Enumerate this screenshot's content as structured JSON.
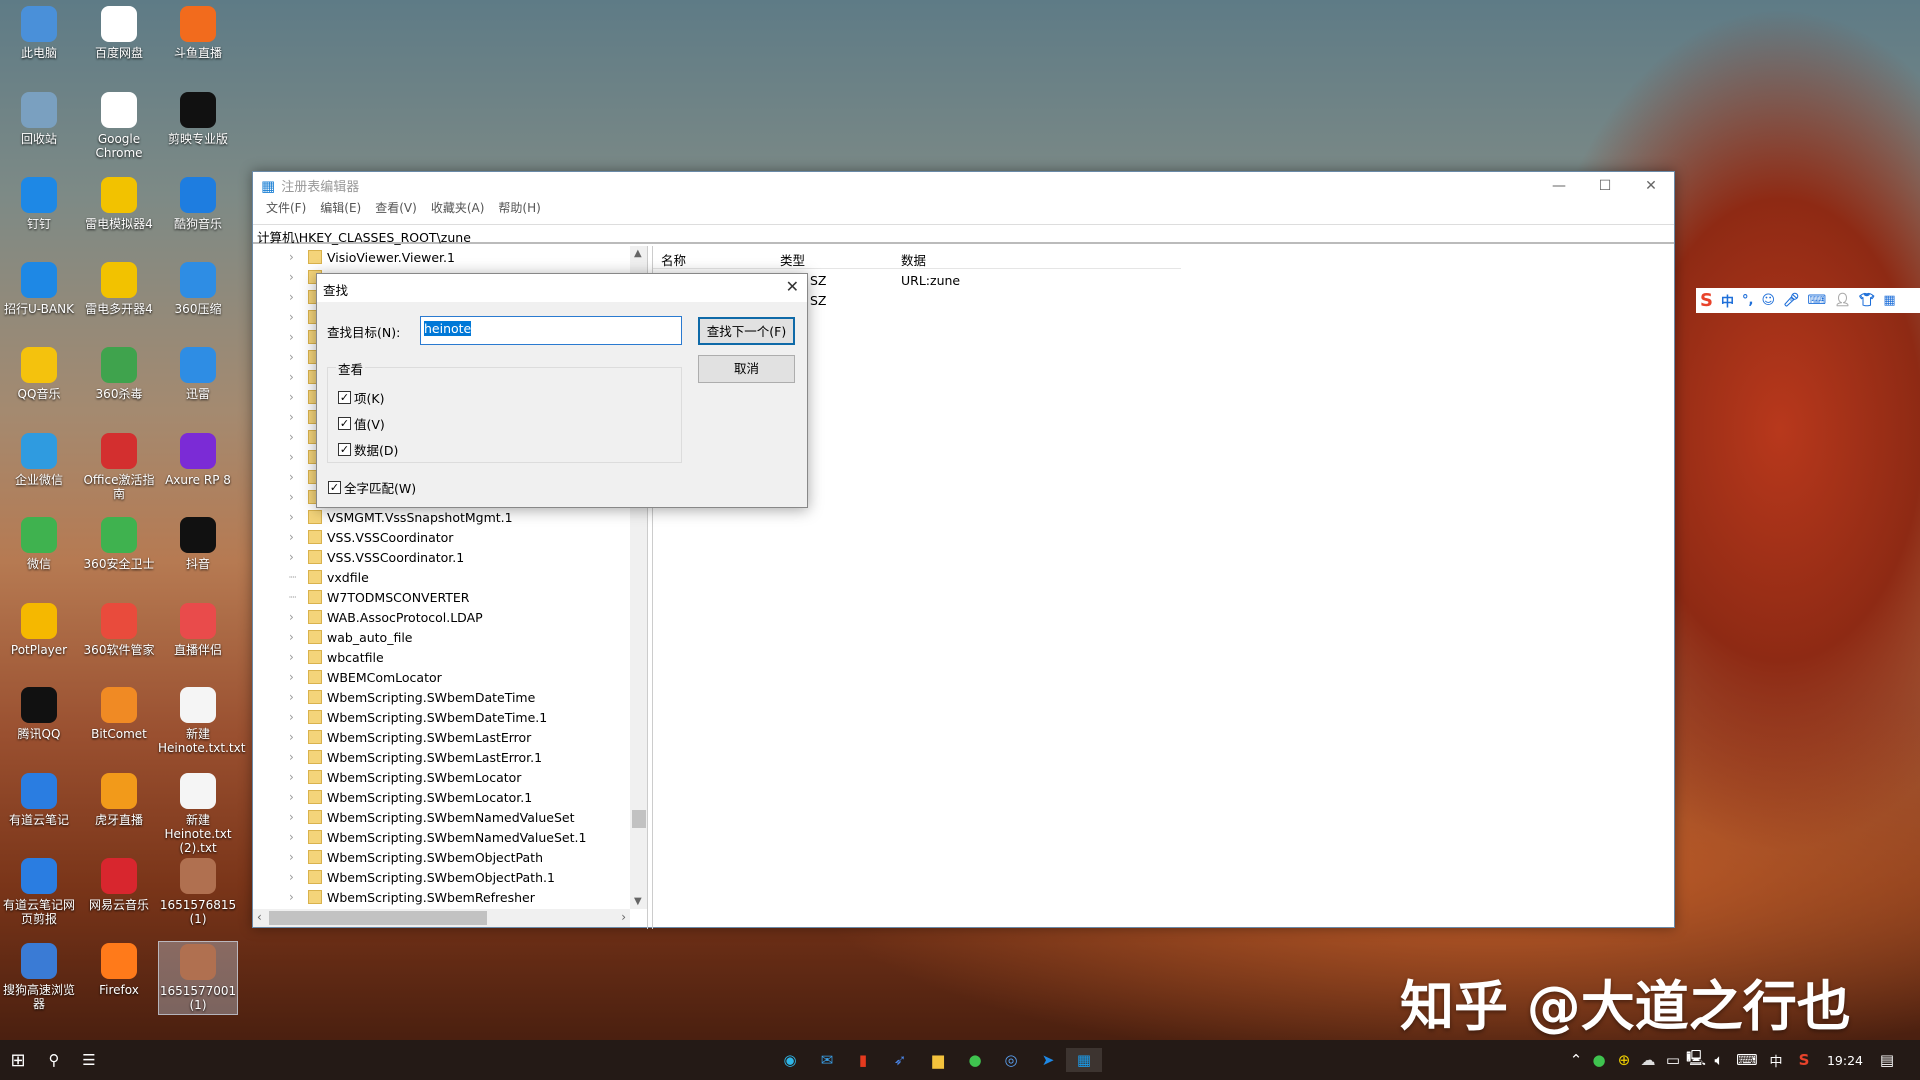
{
  "desktop": {
    "columns": [
      [
        "此电脑",
        "回收站",
        "钉钉",
        "招行U-BANK",
        "QQ音乐",
        "企业微信",
        "微信",
        "PotPlayer",
        "腾讯QQ",
        "有道云笔记",
        "有道云笔记网页剪报",
        "搜狗高速浏览器"
      ],
      [
        "百度网盘",
        "Google Chrome",
        "雷电模拟器4",
        "雷电多开器4",
        "360杀毒",
        "Office激活指南",
        "360安全卫士",
        "360软件管家",
        "BitComet",
        "虎牙直播",
        "网易云音乐",
        "Firefox"
      ],
      [
        "斗鱼直播",
        "剪映专业版",
        "酷狗音乐",
        "360压缩",
        "迅雷",
        "Axure RP 8",
        "抖音",
        "直播伴侣",
        "新建Heinote.txt.txt",
        "新建Heinote.txt (2).txt",
        "1651576815 (1)",
        "1651577001 (1)"
      ]
    ],
    "colors": [
      [
        "#4a90d9",
        "#7aa0c0",
        "#1e88e5",
        "#1e88e5",
        "#f4c20d",
        "#2f9be0",
        "#3fb24f",
        "#f5b800",
        "#111",
        "#2a7de1",
        "#2a7de1",
        "#3a7bd5"
      ],
      [
        "#ffffff",
        "#ffffff",
        "#f2c200",
        "#f2c200",
        "#3fa34d",
        "#d32f2f",
        "#3fb24f",
        "#e94b3c",
        "#f08a24",
        "#f29a1a",
        "#d8262e",
        "#ff7a1a"
      ],
      [
        "#f26b1d",
        "#111",
        "#1e7de0",
        "#2e8de4",
        "#2e8de4",
        "#7b2bd6",
        "#111",
        "#e94b4b",
        "#f5f5f5",
        "#f5f5f5",
        "#b07050",
        "#b07050"
      ]
    ],
    "selected": "1651577001 (1)"
  },
  "regedit": {
    "title": "注册表编辑器",
    "menu": [
      "文件(F)",
      "编辑(E)",
      "查看(V)",
      "收藏夹(A)",
      "帮助(H)"
    ],
    "address": "计算机\\HKEY_CLASSES_ROOT\\zune",
    "tree_top": [
      "VisioViewer.Viewer.1"
    ],
    "tree": [
      "VSMGMT.VssSnapshotMgmt.1",
      "VSS.VSSCoordinator",
      "VSS.VSSCoordinator.1",
      "vxdfile",
      "W7TODMSCONVERTER",
      "WAB.AssocProtocol.LDAP",
      "wab_auto_file",
      "wbcatfile",
      "WBEMComLocator",
      "WbemScripting.SWbemDateTime",
      "WbemScripting.SWbemDateTime.1",
      "WbemScripting.SWbemLastError",
      "WbemScripting.SWbemLastError.1",
      "WbemScripting.SWbemLocator",
      "WbemScripting.SWbemLocator.1",
      "WbemScripting.SWbemNamedValueSet",
      "WbemScripting.SWbemNamedValueSet.1",
      "WbemScripting.SWbemObjectPath",
      "WbemScripting.SWbemObjectPath.1",
      "WbemScripting.SWbemRefresher"
    ],
    "columns": {
      "name": "名称",
      "type": "类型",
      "data": "数据"
    },
    "values": [
      {
        "type": "SZ",
        "data": "URL:zune"
      },
      {
        "type": "SZ",
        "data": ""
      }
    ]
  },
  "find": {
    "title": "查找",
    "target_label": "查找目标(N):",
    "target_value": "heinote",
    "find_next": "查找下一个(F)",
    "cancel": "取消",
    "group": "查看",
    "options": [
      {
        "label": "项(K)",
        "checked": true
      },
      {
        "label": "值(V)",
        "checked": true
      },
      {
        "label": "数据(D)",
        "checked": true
      }
    ],
    "whole_word": {
      "label": "全字匹配(W)",
      "checked": true
    }
  },
  "taskbar": {
    "time": "19:24",
    "ime": "中"
  },
  "ime_bar": {
    "mode": "中"
  },
  "watermark": "知乎 @大道之行也"
}
